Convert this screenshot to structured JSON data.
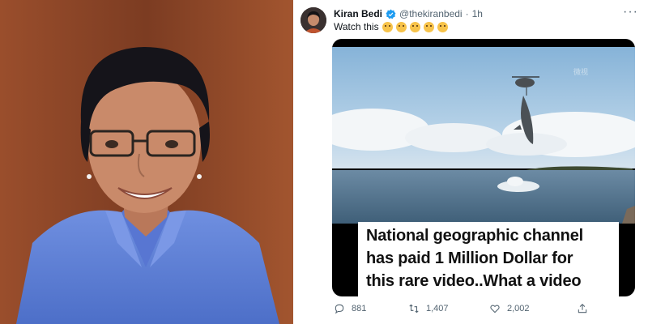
{
  "tweet": {
    "author_name": "Kiran Bedi",
    "handle": "@thekiranbedi",
    "separator": "·",
    "time": "1h",
    "text": "Watch this",
    "emojis": [
      "smiling-face",
      "smiling-face",
      "rolling-eyes-face",
      "flushed-face",
      "astonished-face"
    ],
    "more_label": "···"
  },
  "media": {
    "watermark": "微视",
    "caption_lines": [
      "National geographic channel",
      "has paid 1 Million Dollar for",
      "this rare  video..What a video"
    ]
  },
  "actions": {
    "reply_count": "881",
    "retweet_count": "1,407",
    "like_count": "2,002"
  },
  "colors": {
    "verified": "#1d9bf0",
    "secondary_text": "#536471",
    "sky": "#9fc4e0",
    "sea": "#5a7d98"
  }
}
